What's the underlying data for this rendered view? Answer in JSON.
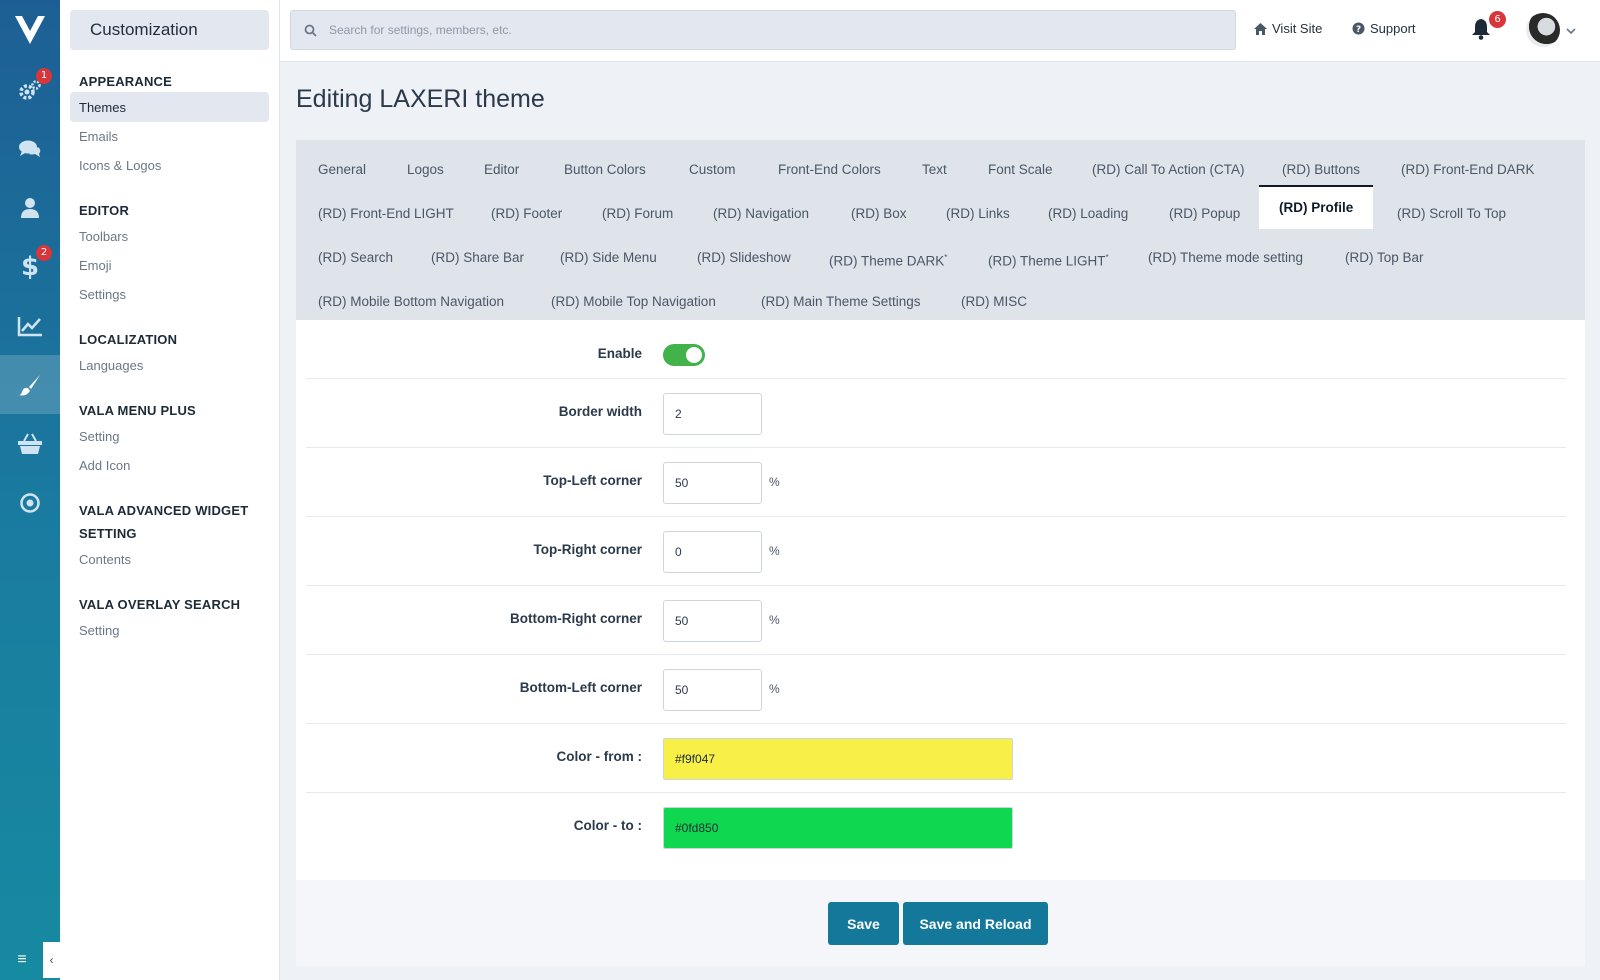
{
  "app": {
    "rail": {
      "items": [
        {
          "icon": "gears-icon",
          "badge": "1"
        },
        {
          "icon": "chat-icon",
          "badge": ""
        },
        {
          "icon": "user-icon",
          "badge": ""
        },
        {
          "icon": "dollar-icon",
          "badge": "2"
        },
        {
          "icon": "chart-icon",
          "badge": ""
        },
        {
          "icon": "brush-icon",
          "badge": "",
          "active": true
        },
        {
          "icon": "basket-icon",
          "badge": ""
        },
        {
          "icon": "target-icon",
          "badge": ""
        }
      ]
    }
  },
  "sidebar": {
    "title": "Customization",
    "sections": [
      {
        "title": "APPEARANCE",
        "items": [
          "Themes",
          "Emails",
          "Icons & Logos"
        ]
      },
      {
        "title": "EDITOR",
        "items": [
          "Toolbars",
          "Emoji",
          "Settings"
        ]
      },
      {
        "title": "LOCALIZATION",
        "items": [
          "Languages"
        ]
      },
      {
        "title": "VALA MENU PLUS",
        "items": [
          "Setting",
          "Add Icon"
        ]
      },
      {
        "title": "VALA ADVANCED WIDGET SETTING",
        "items": [
          "Contents"
        ]
      },
      {
        "title": "VALA OVERLAY SEARCH",
        "items": [
          "Setting"
        ]
      }
    ],
    "active_item": "Themes"
  },
  "topbar": {
    "search_placeholder": "Search for settings, members, etc.",
    "visit_site": "Visit Site",
    "support": "Support",
    "notifications_count": "6"
  },
  "main": {
    "title": "Editing LAXERI theme",
    "tabs": [
      "General",
      "Logos",
      "Editor",
      "Button Colors",
      "Custom",
      "Front-End Colors",
      "Text",
      "Font Scale",
      "(RD) Call To Action (CTA)",
      "(RD) Buttons",
      "(RD) Front-End DARK",
      "(RD) Front-End LIGHT",
      "(RD) Footer",
      "(RD) Forum",
      "(RD) Navigation",
      "(RD) Box",
      "(RD) Links",
      "(RD) Loading",
      "(RD) Popup",
      "(RD) Profile",
      "(RD) Scroll To Top",
      "(RD) Search",
      "(RD) Share Bar",
      "(RD) Side Menu",
      "(RD) Slideshow",
      "(RD) Theme DARK",
      "(RD) Theme LIGHT",
      "(RD) Theme mode setting",
      "(RD) Top Bar",
      "(RD) Mobile Bottom Navigation",
      "(RD) Mobile Top Navigation",
      "(RD) Main Theme Settings",
      "(RD) MISC"
    ],
    "tab_marker": "*",
    "active_tab": "(RD) Profile",
    "fields": {
      "enable": {
        "label": "Enable",
        "value": true
      },
      "border_width": {
        "label": "Border width",
        "value": "2"
      },
      "top_left": {
        "label": "Top-Left corner",
        "value": "50",
        "unit": "%"
      },
      "top_right": {
        "label": "Top-Right corner",
        "value": "0",
        "unit": "%"
      },
      "bottom_right": {
        "label": "Bottom-Right corner",
        "value": "50",
        "unit": "%"
      },
      "bottom_left": {
        "label": "Bottom-Left corner",
        "value": "50",
        "unit": "%"
      },
      "color_from": {
        "label": "Color - from :",
        "value": "#f9f047"
      },
      "color_to": {
        "label": "Color - to :",
        "value": "#0fd850"
      }
    },
    "buttons": {
      "save": "Save",
      "save_reload": "Save and Reload"
    }
  },
  "colors": {
    "accent": "#14789a",
    "toggle_on": "#42b24a",
    "badge": "#d9353b"
  }
}
